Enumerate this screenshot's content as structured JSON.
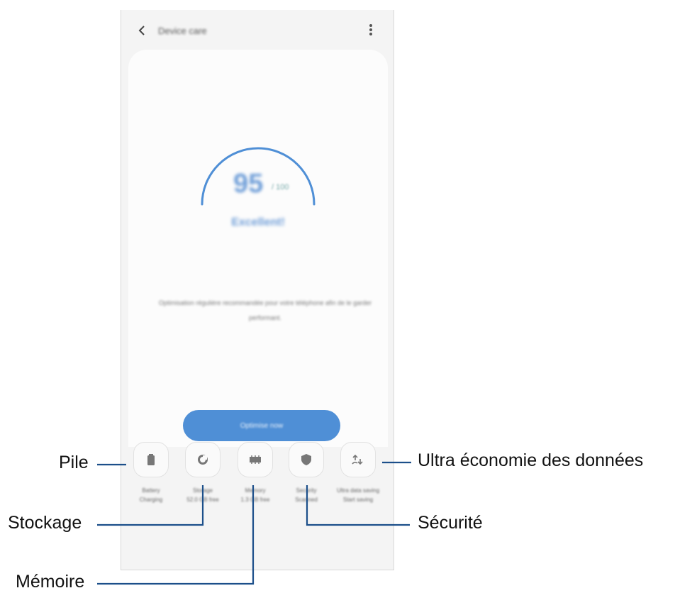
{
  "app": {
    "title": "Device care",
    "score": "95",
    "score_max": "/ 100",
    "status": "Excellent!",
    "description": "Optimisation régulière recommandée pour votre téléphone afin de le garder performant.",
    "optimize_label": "Optimise now"
  },
  "shortcuts": [
    {
      "label": "Battery",
      "sub": "Charging",
      "icon": "battery-icon"
    },
    {
      "label": "Storage",
      "sub": "52.0 GB free",
      "icon": "storage-icon"
    },
    {
      "label": "Memory",
      "sub": "1.3 GB free",
      "icon": "memory-icon"
    },
    {
      "label": "Security",
      "sub": "Scanned",
      "icon": "shield-icon"
    },
    {
      "label": "Ultra data saving",
      "sub": "Start saving",
      "icon": "data-saving-icon"
    }
  ],
  "annotations": {
    "pile": "Pile",
    "stockage": "Stockage",
    "memoire": "Mémoire",
    "ultra": "Ultra économie des données",
    "securite": "Sécurité"
  },
  "colors": {
    "accent": "#4f8fd6",
    "line": "#1c4f8a"
  }
}
